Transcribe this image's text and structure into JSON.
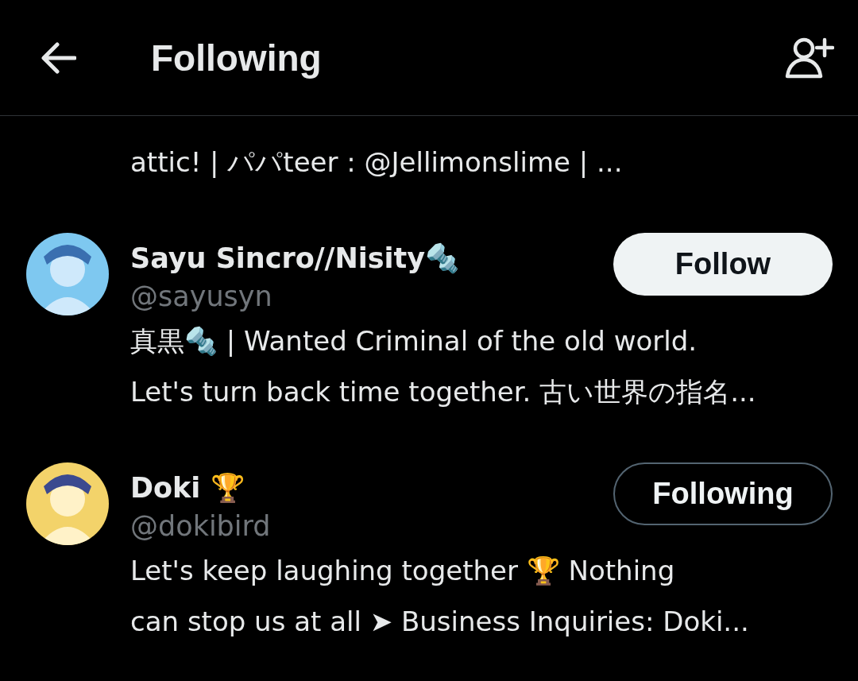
{
  "header": {
    "title": "Following"
  },
  "fragment_lines": [
    "attic! | パパteer : @Jellimonslime | ..."
  ],
  "users": [
    {
      "name": "Sayu Sincro//Nisity🔩",
      "handle": "@sayusyn",
      "following": false,
      "button": "Follow",
      "bio_lines": [
        "真黒🔩 | Wanted Criminal of the old world.",
        "Let's turn back time together. 古い世界の指名..."
      ]
    },
    {
      "name": "Doki 🏆",
      "handle": "@dokibird",
      "following": true,
      "button": "Following",
      "bio_lines": [
        "Let's keep laughing together 🏆 Nothing",
        "can stop us at all ➤ Business Inquiries: Doki..."
      ]
    }
  ]
}
